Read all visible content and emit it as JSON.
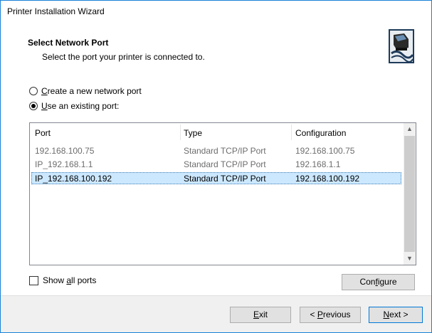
{
  "window": {
    "title": "Printer Installation Wizard"
  },
  "header": {
    "title": "Select Network Port",
    "subtitle": "Select the port your printer is connected to.",
    "icon": "printer-network-icon"
  },
  "options": {
    "create_new": {
      "prefix": "",
      "accel": "C",
      "rest": "reate a new network port",
      "checked": false
    },
    "use_existing": {
      "prefix": "",
      "accel": "U",
      "rest": "se an existing port:",
      "checked": true
    }
  },
  "ports_table": {
    "columns": [
      "Port",
      "Type",
      "Configuration"
    ],
    "rows": [
      {
        "port": "192.168.100.75",
        "type": "Standard TCP/IP Port",
        "config": "192.168.100.75",
        "selected": false
      },
      {
        "port": "IP_192.168.1.1",
        "type": "Standard TCP/IP Port",
        "config": "192.168.1.1",
        "selected": false
      },
      {
        "port": "IP_192.168.100.192",
        "type": "Standard TCP/IP Port",
        "config": "192.168.100.192",
        "selected": true
      }
    ]
  },
  "show_all": {
    "prefix": "Show ",
    "accel": "a",
    "rest": "ll ports",
    "checked": false
  },
  "buttons": {
    "configure": {
      "prefix": "Con",
      "accel": "f",
      "rest": "igure"
    },
    "exit": {
      "prefix": "",
      "accel": "E",
      "rest": "xit"
    },
    "previous": {
      "prefix": "< ",
      "accel": "P",
      "rest": "revious"
    },
    "next": {
      "prefix": "",
      "accel": "N",
      "rest": "ext >"
    }
  },
  "colors": {
    "selection": "#cce8ff",
    "accent": "#0078d7",
    "window_border": "#1883d7"
  }
}
